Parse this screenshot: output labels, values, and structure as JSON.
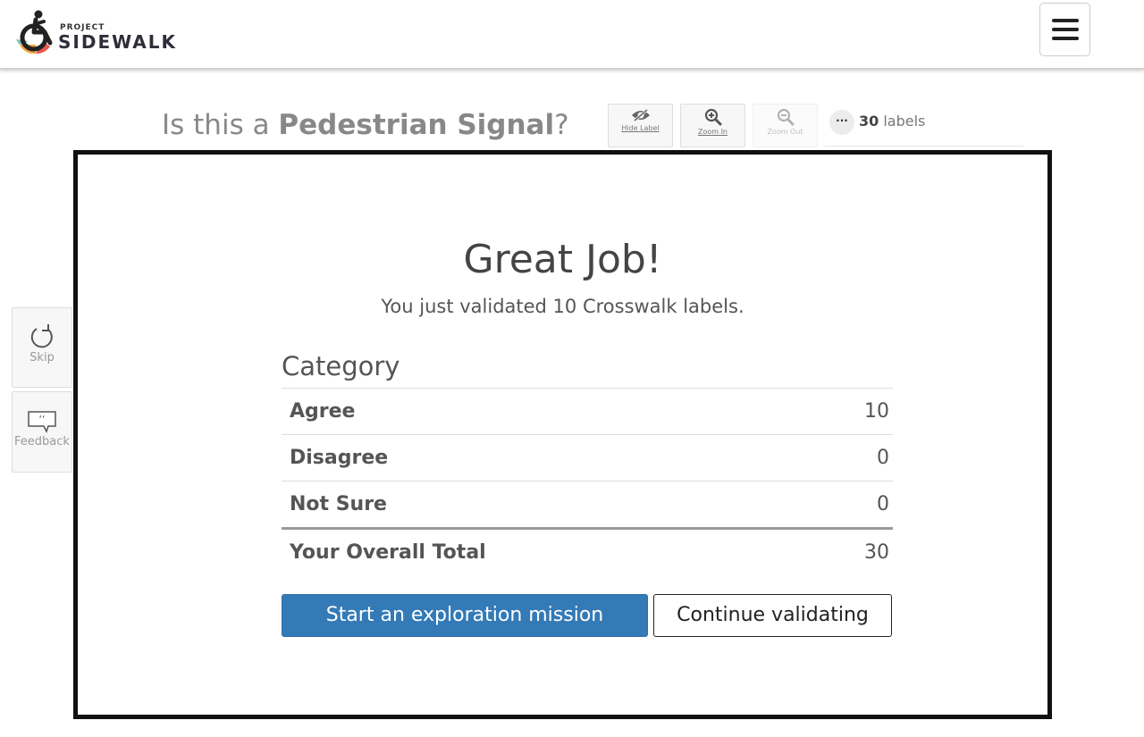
{
  "header": {
    "logo_small": "PROJECT",
    "logo_big": "SIDEWALK",
    "menu_icon": "hamburger-icon"
  },
  "question": {
    "prefix": "Is this a ",
    "label_type": "Pedestrian Signal",
    "suffix": "?"
  },
  "toolbar": {
    "hide_label": "Hide Label",
    "zoom_in": "Zoom In",
    "zoom_out": "Zoom Out",
    "more": "···",
    "count": "30",
    "count_unit": " labels"
  },
  "side": {
    "skip": "Skip",
    "feedback": "Feedback"
  },
  "modal": {
    "title": "Great Job!",
    "subtitle": "You just validated 10 Crosswalk labels.",
    "category_heading": "Category",
    "rows": [
      {
        "label": "Agree",
        "value": "10"
      },
      {
        "label": "Disagree",
        "value": "0"
      },
      {
        "label": "Not Sure",
        "value": "0"
      }
    ],
    "total": {
      "label": "Your Overall Total",
      "value": "30"
    },
    "primary_button": "Start an exploration mission",
    "secondary_button": "Continue validating"
  },
  "colors": {
    "primary": "#337ab7",
    "border": "#111111"
  }
}
